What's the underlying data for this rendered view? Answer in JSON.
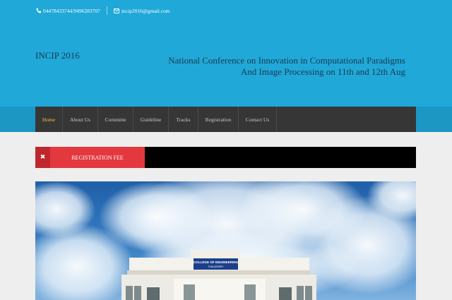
{
  "contact": {
    "phone_icon": "phone-icon",
    "phone": "04478433744/9496283707",
    "mail_icon": "envelope-icon",
    "email": "incip2016@gmail.com"
  },
  "header": {
    "brand": "INCIP 2016",
    "tagline_line1": "National Conference on Innovation in Computational Paradigms",
    "tagline_line2": "And Image Processing on 11th and 12th Aug"
  },
  "nav": {
    "items": [
      {
        "label": "Home",
        "active": true
      },
      {
        "label": "About Us",
        "active": false
      },
      {
        "label": "Committe",
        "active": false
      },
      {
        "label": "Guideline",
        "active": false
      },
      {
        "label": "Tracks",
        "active": false
      },
      {
        "label": "Registration",
        "active": false
      },
      {
        "label": "Contact Us",
        "active": false
      }
    ]
  },
  "notice": {
    "close_icon": "close-icon",
    "label": "REGISTRATION FEE"
  },
  "banner": {
    "image": "college-building-photo",
    "sign_line1": "COLLEGE OF ENGINEERING",
    "sign_line2": "THALASSERY"
  },
  "colors": {
    "header_bg": "#20a8d8",
    "nav_bg": "#363636",
    "active_link": "#f2c14e",
    "notice_red": "#e3383e"
  }
}
